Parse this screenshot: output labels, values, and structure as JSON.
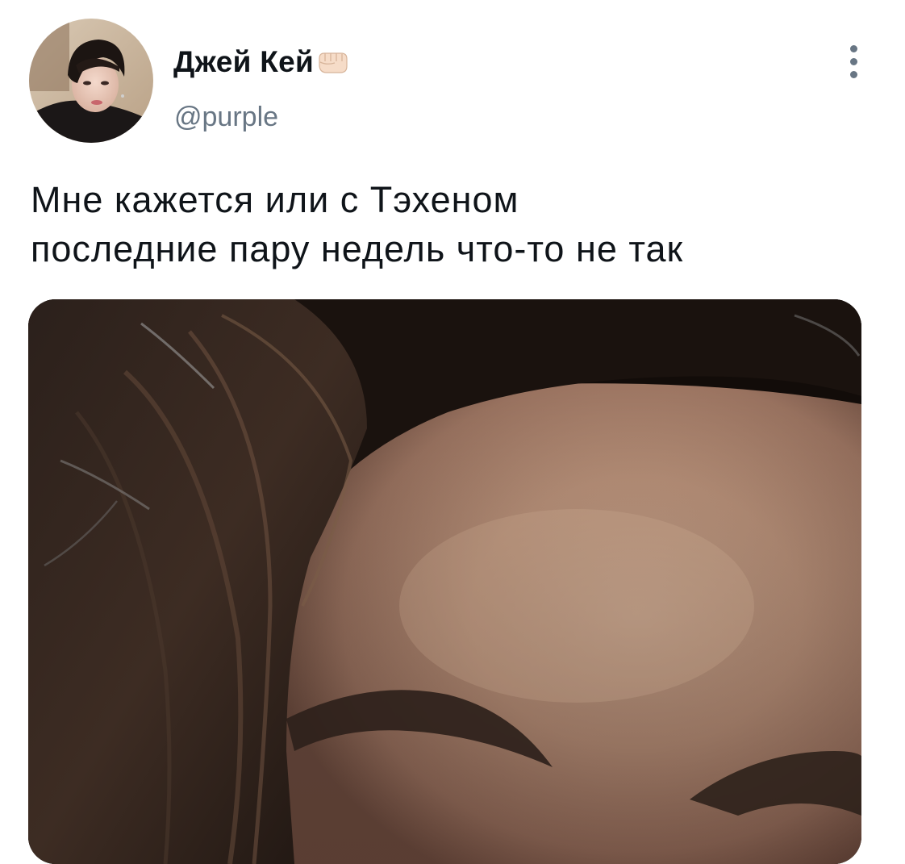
{
  "tweet": {
    "author": {
      "display_name": "Джей Кей",
      "name_emoji": "fist-icon",
      "handle": "@purple"
    },
    "text_lines": [
      "Мне кажется или с Тэхеном",
      "последние пару недель что-то не так"
    ],
    "more_icon": "more-vertical-icon",
    "colors": {
      "text": "#0f1419",
      "secondary_text": "#687684",
      "background": "#ffffff"
    }
  }
}
